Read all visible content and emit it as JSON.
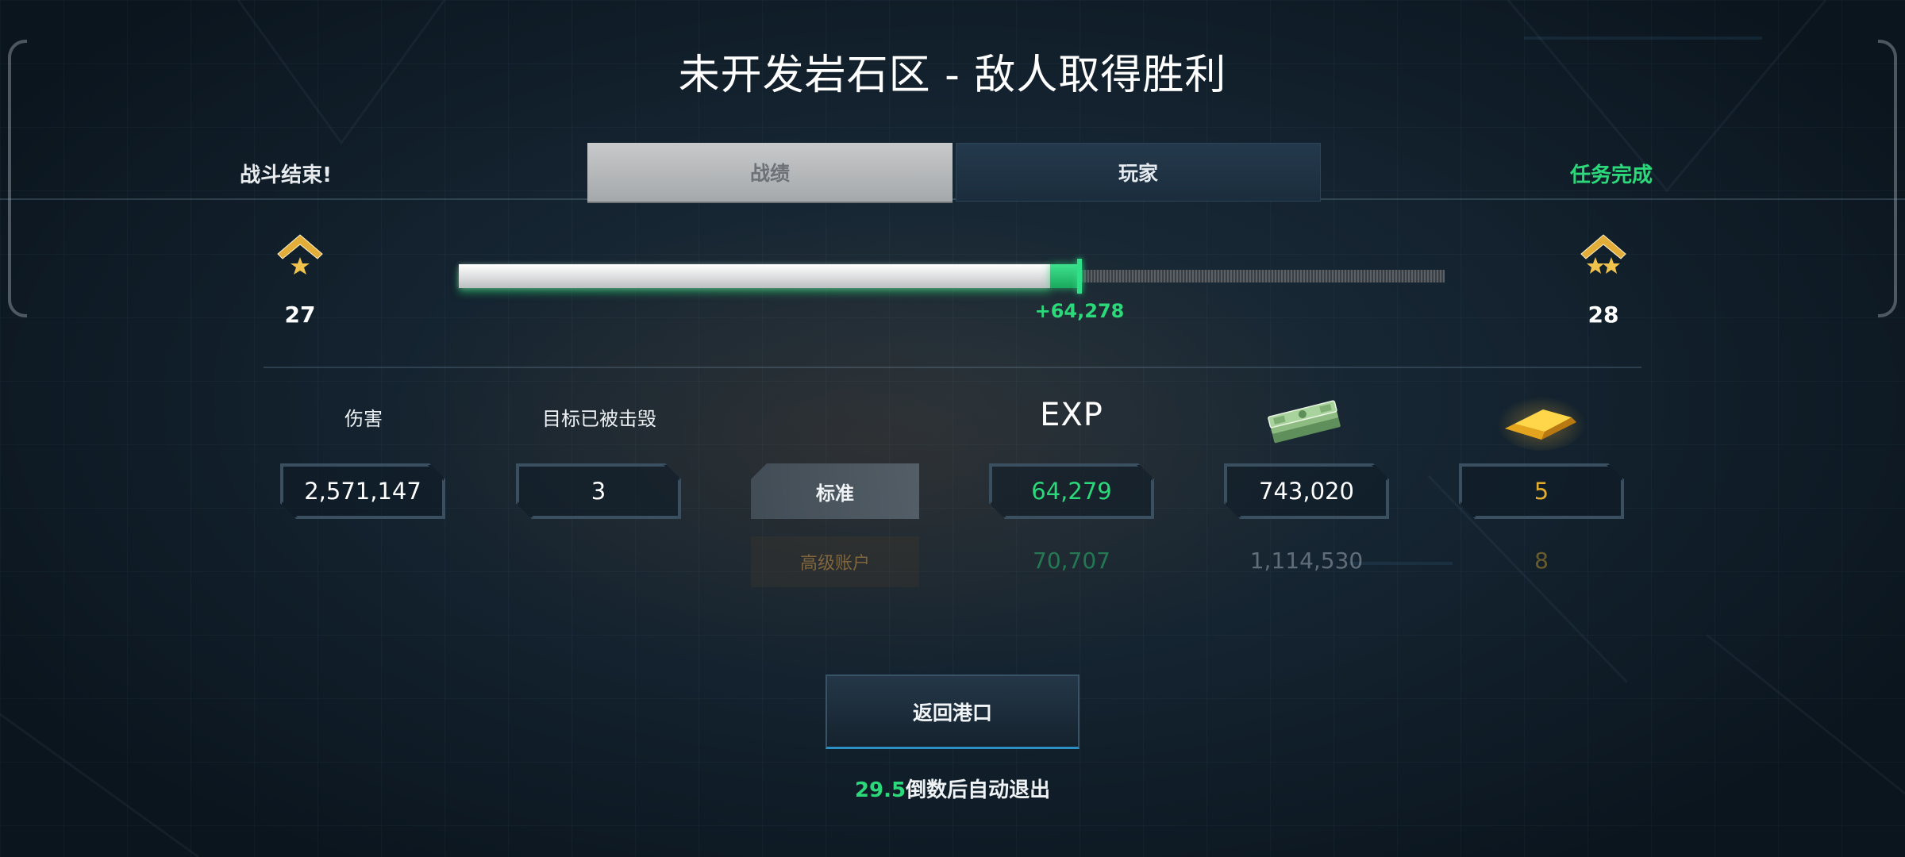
{
  "title": "未开发岩石区 - 敌人取得胜利",
  "status_left": "战斗结束!",
  "status_right": "任务完成",
  "tabs": [
    {
      "label": "战绩",
      "active": true
    },
    {
      "label": "玩家",
      "active": false
    }
  ],
  "rank": {
    "current_level": "27",
    "next_level": "28",
    "current_icon": "rank-chevron-one-star-icon",
    "next_icon": "rank-chevron-two-star-icon"
  },
  "progress": {
    "base_fraction": 0.6,
    "gained_fraction": 0.03,
    "gain_label": "+64,278"
  },
  "stats": {
    "damage_label": "伤害",
    "damage_value": "2,571,147",
    "kills_label": "目标已被击毁",
    "kills_value": "3"
  },
  "rewards": {
    "exp_header": "EXP",
    "credits_icon": "cash-stack-icon",
    "gold_icon": "gold-bar-icon",
    "standard": {
      "label": "标准",
      "exp": "64,279",
      "credits": "743,020",
      "gold": "5"
    },
    "premium": {
      "label": "高级账户",
      "exp": "70,707",
      "credits": "1,114,530",
      "gold": "8"
    }
  },
  "return_button": "返回港口",
  "countdown": {
    "seconds": "29.5",
    "text": "倒数后自动退出"
  },
  "colors": {
    "accent_green": "#2bd97a",
    "gold": "#e2ad2c",
    "background": "#13222e"
  }
}
